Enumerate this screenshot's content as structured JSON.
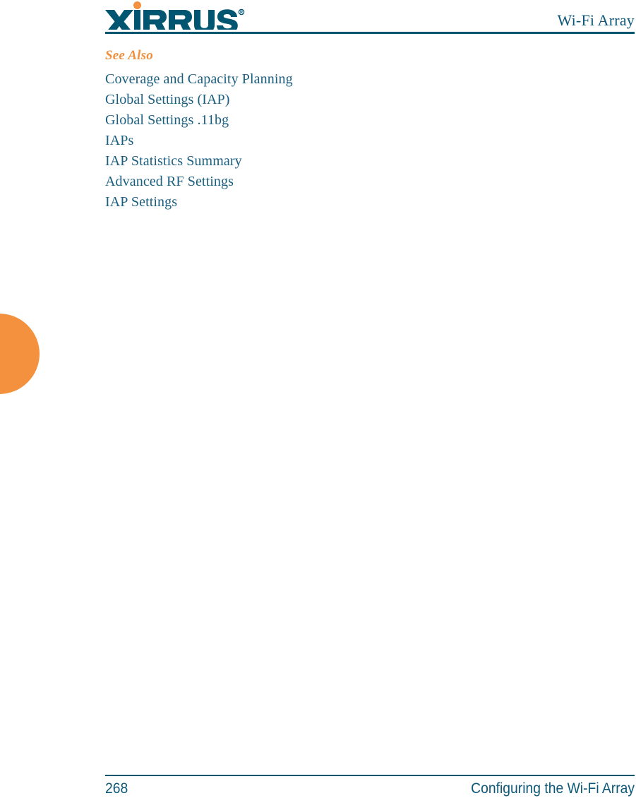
{
  "header": {
    "logo_text": "XIRRUS",
    "logo_registered_mark": "®",
    "logo_icon": "xirrus-logo",
    "title": "Wi-Fi Array"
  },
  "content": {
    "see_also_heading": "See Also",
    "links": [
      {
        "label": "Coverage and Capacity Planning"
      },
      {
        "label": "Global Settings (IAP)"
      },
      {
        "label": "Global Settings .11bg"
      },
      {
        "label": "IAPs"
      },
      {
        "label": "IAP Statistics Summary"
      },
      {
        "label": "Advanced RF Settings"
      },
      {
        "label": "IAP Settings"
      }
    ]
  },
  "footer": {
    "page_number": "268",
    "chapter": "Configuring the Wi-Fi Array"
  },
  "colors": {
    "brand_teal": "#00556e",
    "link_teal": "#1a5f80",
    "accent_orange": "#f0903c",
    "tab_orange": "#f4913e",
    "page_background": "#ffffff"
  }
}
